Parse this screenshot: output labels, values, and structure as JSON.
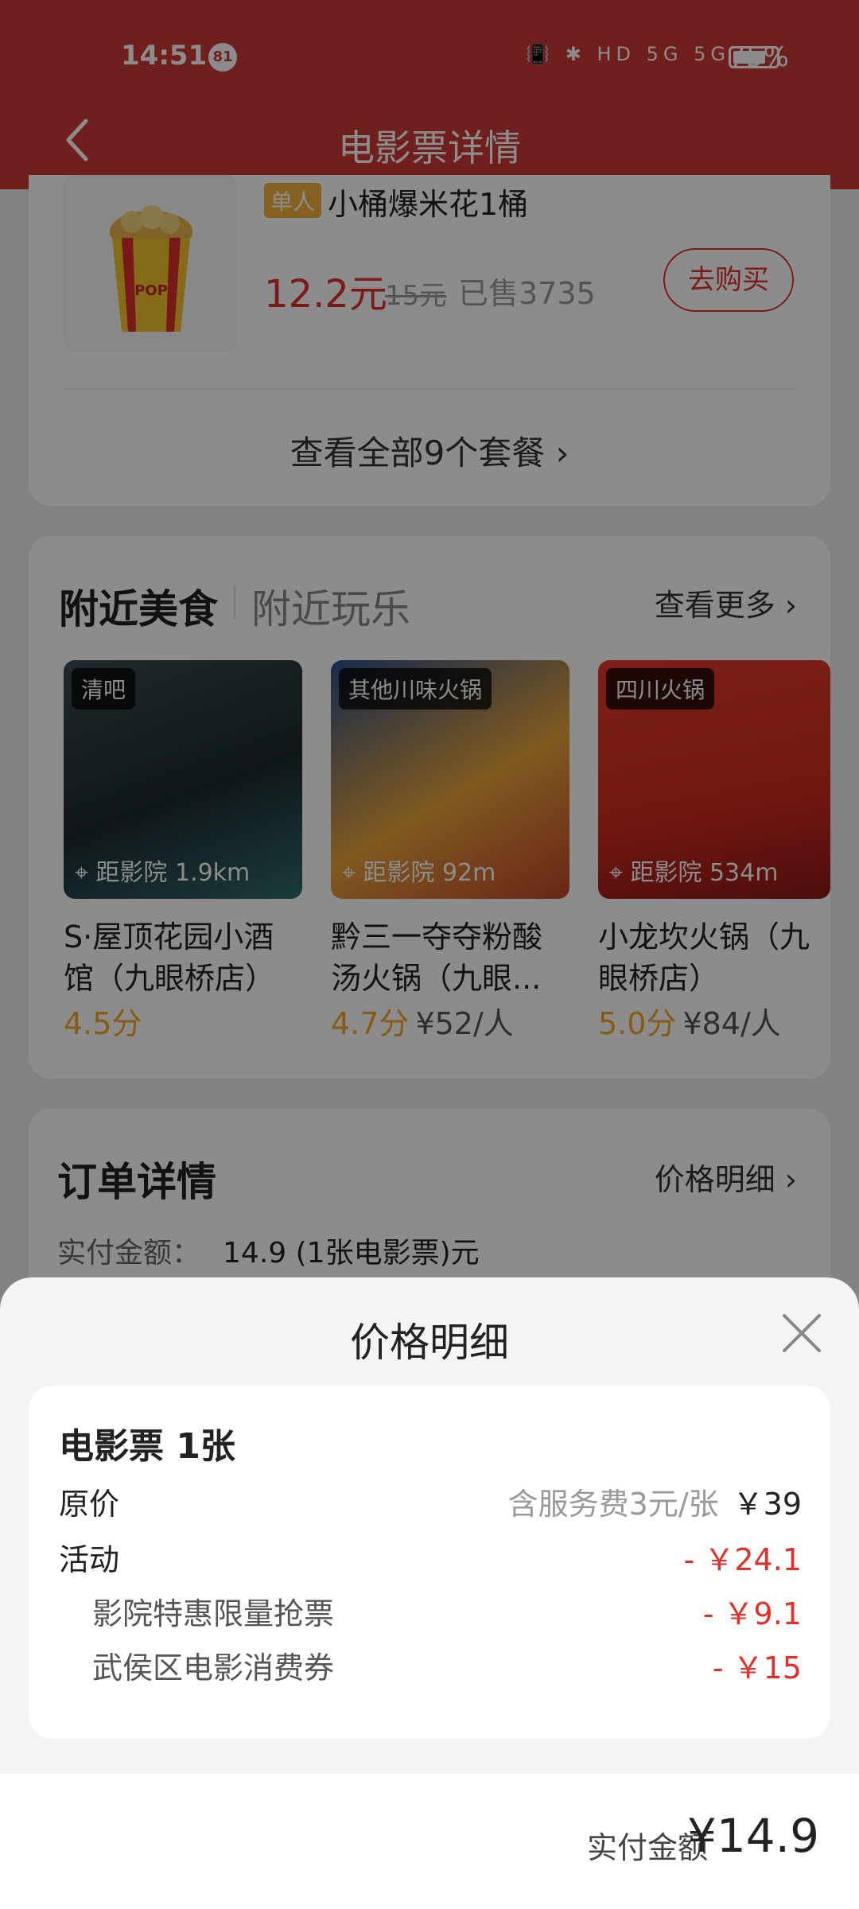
{
  "status_bar": {
    "time": "14:51",
    "notification_count": "81",
    "network_icons": "📳 ✱ HD 5G 5G",
    "battery_pct": "75%"
  },
  "header": {
    "title": "电影票详情"
  },
  "combo": {
    "tag": "单人",
    "name": "小桶爆米花1桶",
    "price": "12.2元",
    "original_price": "15元",
    "sold": "已售3735",
    "buy_label": "去购买",
    "view_all": "查看全部9个套餐 ›"
  },
  "nearby": {
    "tab_food": "附近美食",
    "tab_fun": "附近玩乐",
    "more": "查看更多 ›",
    "shops": [
      {
        "tag": "清吧",
        "distance": "距影院 1.9km",
        "name": "S·屋顶花园小酒馆（九眼桥店）",
        "rating": "4.5分",
        "per_person": ""
      },
      {
        "tag": "其他川味火锅",
        "distance": "距影院 92m",
        "name": "黔三一夺夺粉酸汤火锅（九眼...",
        "rating": "4.7分",
        "per_person": "¥52/人"
      },
      {
        "tag": "四川火锅",
        "distance": "距影院 534m",
        "name": "小龙坎火锅（九眼桥店）",
        "rating": "5.0分",
        "per_person": "¥84/人"
      }
    ]
  },
  "order": {
    "title": "订单详情",
    "price_detail_link": "价格明细 ›",
    "paid_label": "实付金额：",
    "paid_value": "14.9 (1张电影票)元"
  },
  "sheet": {
    "title": "价格明细",
    "ticket_title": "电影票 1张",
    "rows": [
      {
        "label": "原价",
        "note": "含服务费3元/张",
        "value": "￥39"
      },
      {
        "label": "活动",
        "value": "- ￥24.1"
      },
      {
        "label": "影院特惠限量抢票",
        "value": "- ￥9.1"
      },
      {
        "label": "武侯区电影消费券",
        "value": "- ￥15"
      }
    ],
    "pay_label": "实付金额",
    "pay_amount": "¥14.9"
  },
  "colors": {
    "brand_red": "#cc3a33",
    "price_red": "#e0312a",
    "rating_orange": "#f5a623"
  }
}
